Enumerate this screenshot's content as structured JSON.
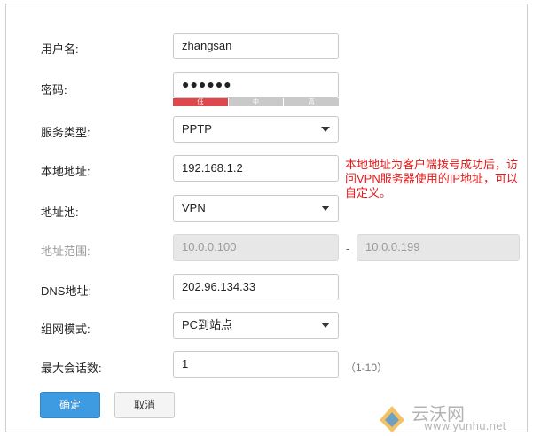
{
  "form": {
    "username": {
      "label": "用户名:",
      "value": "zhangsan"
    },
    "password": {
      "label": "密码:",
      "value": "●●●●●●",
      "strength": {
        "low": "低",
        "mid": "中",
        "high": "高"
      }
    },
    "service_type": {
      "label": "服务类型:",
      "value": "PPTP"
    },
    "local_address": {
      "label": "本地地址:",
      "value": "192.168.1.2"
    },
    "address_pool": {
      "label": "地址池:",
      "value": "VPN"
    },
    "address_range": {
      "label": "地址范围:",
      "start": "10.0.0.100",
      "separator": "-",
      "end": "10.0.0.199"
    },
    "dns_address": {
      "label": "DNS地址:",
      "value": "202.96.134.33"
    },
    "network_mode": {
      "label": "组网模式:",
      "value": "PC到站点"
    },
    "max_sessions": {
      "label": "最大会话数:",
      "value": "1",
      "hint": "（1-10）"
    }
  },
  "annotation": "本地地址为客户端拨号成功后，访问VPN服务器使用的IP地址，可以自定义。",
  "buttons": {
    "confirm": "确定",
    "cancel": "取消"
  },
  "watermark": {
    "logo_text": "云沃网",
    "url": "www.yunhu.net"
  },
  "colors": {
    "accent": "#3e9be2",
    "annotation": "#e8191a",
    "strength_low": "#e0474c"
  }
}
